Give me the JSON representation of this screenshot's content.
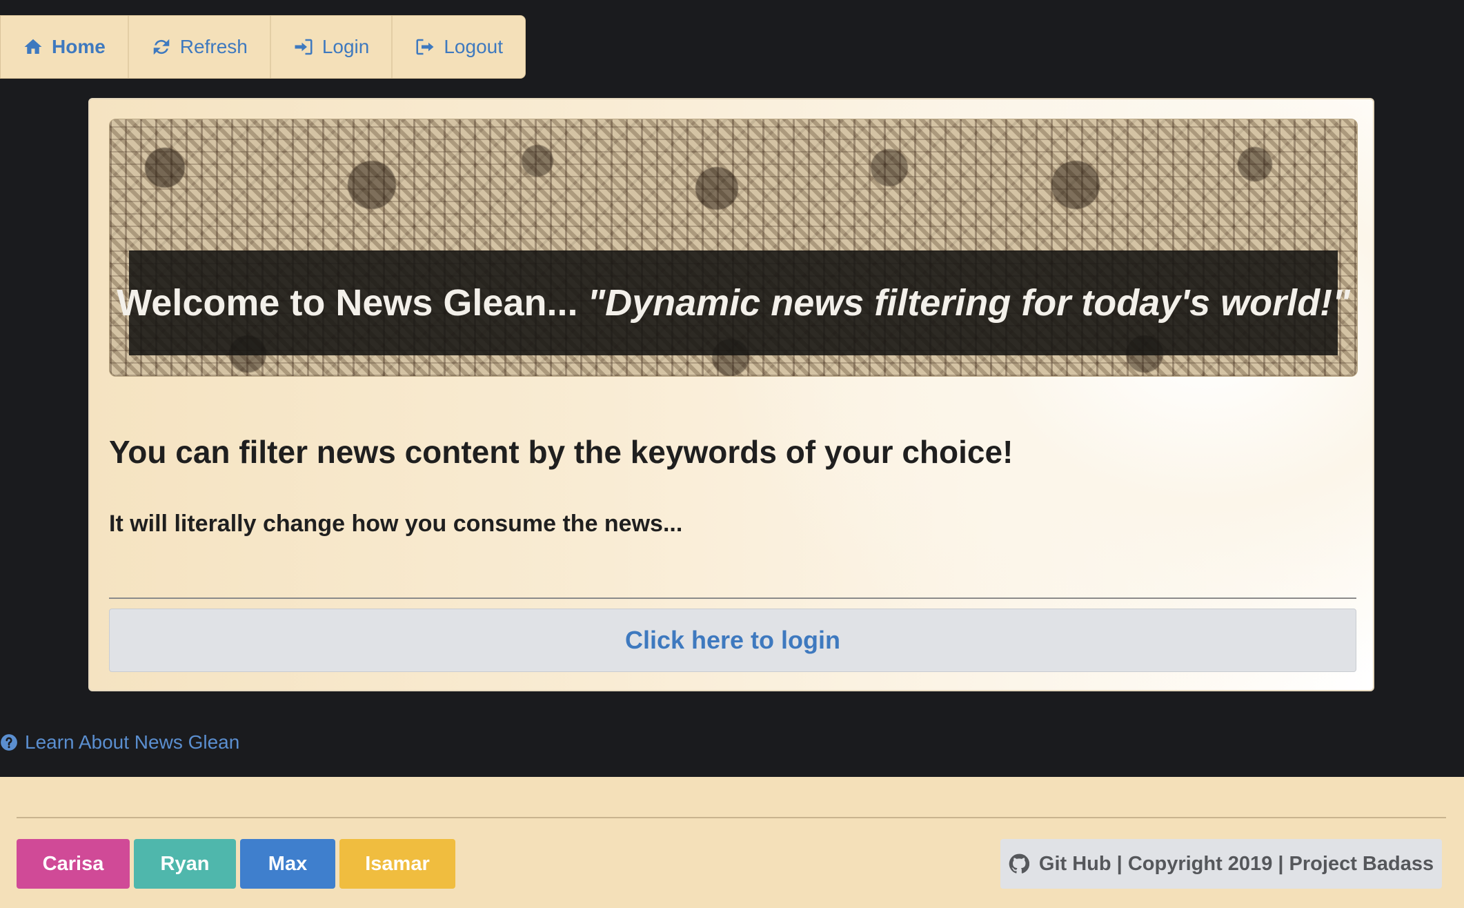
{
  "nav": {
    "items": [
      {
        "label": "Home",
        "icon": "home-icon"
      },
      {
        "label": "Refresh",
        "icon": "refresh-icon"
      },
      {
        "label": "Login",
        "icon": "sign-in-icon"
      },
      {
        "label": "Logout",
        "icon": "sign-out-icon"
      }
    ]
  },
  "banner": {
    "title": "Welcome to News Glean...",
    "tagline": "\"Dynamic news filtering for today's world!\""
  },
  "main": {
    "heading": "You can filter news content by the keywords of your choice!",
    "subheading": "It will literally change how you consume the news...",
    "login_cta": "Click here to login"
  },
  "learn_link": {
    "label": "Learn About News Glean",
    "icon": "question-circle-icon"
  },
  "footer": {
    "team": [
      {
        "name": "Carisa",
        "color": "#d04a97"
      },
      {
        "name": "Ryan",
        "color": "#4fb7ac"
      },
      {
        "name": "Max",
        "color": "#3f7fcd"
      },
      {
        "name": "Isamar",
        "color": "#f0bd3f"
      }
    ],
    "copyright": "Git Hub | Copyright 2019 | Project Badass",
    "copyright_icon": "github-icon"
  },
  "colors": {
    "background": "#1a1b1e",
    "nav_bg": "#f4e0b9",
    "link": "#3e79bf",
    "footer_bg": "#f4e0b9"
  }
}
